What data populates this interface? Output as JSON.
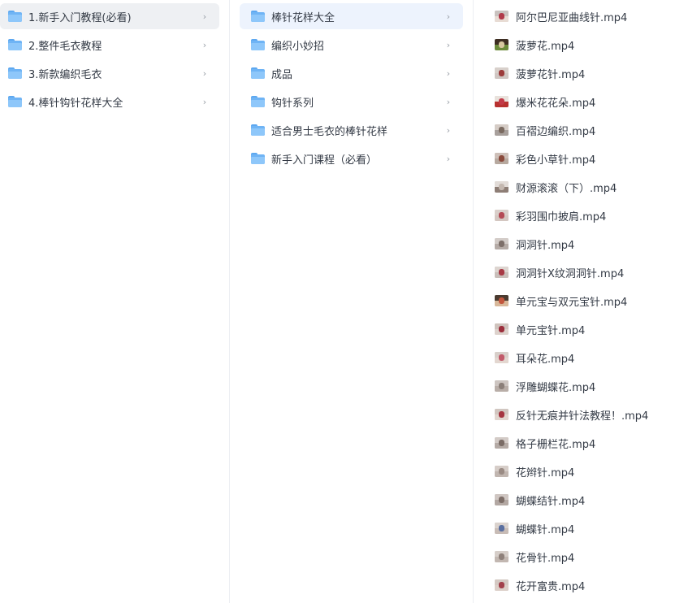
{
  "column1": {
    "items": [
      {
        "label": "1.新手入门教程(必看)"
      },
      {
        "label": "2.整件毛衣教程"
      },
      {
        "label": "3.新款编织毛衣"
      },
      {
        "label": "4.棒针钩针花样大全"
      }
    ],
    "chevron": "›"
  },
  "column2": {
    "items": [
      {
        "label": "棒针花样大全"
      },
      {
        "label": "编织小妙招"
      },
      {
        "label": "成品"
      },
      {
        "label": "钩针系列"
      },
      {
        "label": "适合男士毛衣的棒针花样"
      },
      {
        "label": "新手入门课程（必看）"
      }
    ],
    "chevron": "›"
  },
  "column3": {
    "files": [
      {
        "name": "阿尔巴尼亚曲线针.mp4"
      },
      {
        "name": "菠萝花.mp4"
      },
      {
        "name": "菠萝花针.mp4"
      },
      {
        "name": "爆米花花朵.mp4"
      },
      {
        "name": "百褶边编织.mp4"
      },
      {
        "name": "彩色小草针.mp4"
      },
      {
        "name": "财源滚滚（下）.mp4"
      },
      {
        "name": "彩羽围巾披肩.mp4"
      },
      {
        "name": "洞洞针.mp4"
      },
      {
        "name": "洞洞针X纹洞洞针.mp4"
      },
      {
        "name": "单元宝与双元宝针.mp4"
      },
      {
        "name": "单元宝针.mp4"
      },
      {
        "name": "耳朵花.mp4"
      },
      {
        "name": "浮雕蝴蝶花.mp4"
      },
      {
        "name": "反针无痕并针法教程！.mp4"
      },
      {
        "name": "格子栅栏花.mp4"
      },
      {
        "name": "花辫针.mp4"
      },
      {
        "name": "蝴蝶结针.mp4"
      },
      {
        "name": "蝴蝶针.mp4"
      },
      {
        "name": "花骨针.mp4"
      },
      {
        "name": "花开富贵.mp4"
      }
    ]
  },
  "colors": {
    "selected_bg": "#eef0f3",
    "highlight_bg": "#edf3fd",
    "folder_blue": "#6fb4f5",
    "text": "#333a45",
    "chevron": "#9aa0a8"
  }
}
